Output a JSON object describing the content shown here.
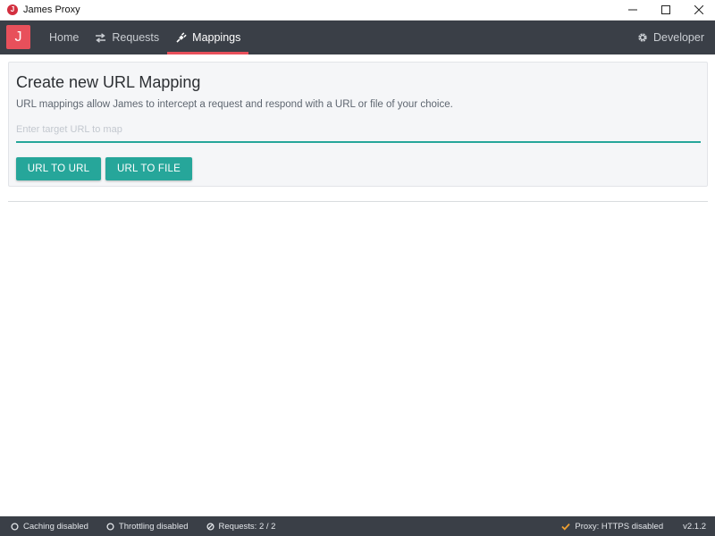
{
  "window": {
    "title": "James Proxy",
    "app_icon_letter": "J"
  },
  "navbar": {
    "logo_letter": "J",
    "items": [
      {
        "label": "Home",
        "icon": "none"
      },
      {
        "label": "Requests",
        "icon": "swap-arrows-icon"
      },
      {
        "label": "Mappings",
        "icon": "plug-icon",
        "active": true
      }
    ],
    "right_item": {
      "label": "Developer",
      "icon": "gear-icon"
    },
    "active_color": "#e8505b",
    "background": "#3a3f47"
  },
  "mapping_card": {
    "title": "Create new URL Mapping",
    "description": "URL mappings allow James to intercept a request and respond with a URL or file of your choice.",
    "input_placeholder": "Enter target URL to map",
    "input_value": "",
    "buttons": {
      "url_to_url": "URL TO URL",
      "url_to_file": "URL TO FILE"
    },
    "accent_color": "#26a69a"
  },
  "statusbar": {
    "caching": "Caching disabled",
    "throttling": "Throttling disabled",
    "requests": "Requests: 2 / 2",
    "proxy": "Proxy: HTTPS disabled",
    "version": "v2.1.2"
  }
}
